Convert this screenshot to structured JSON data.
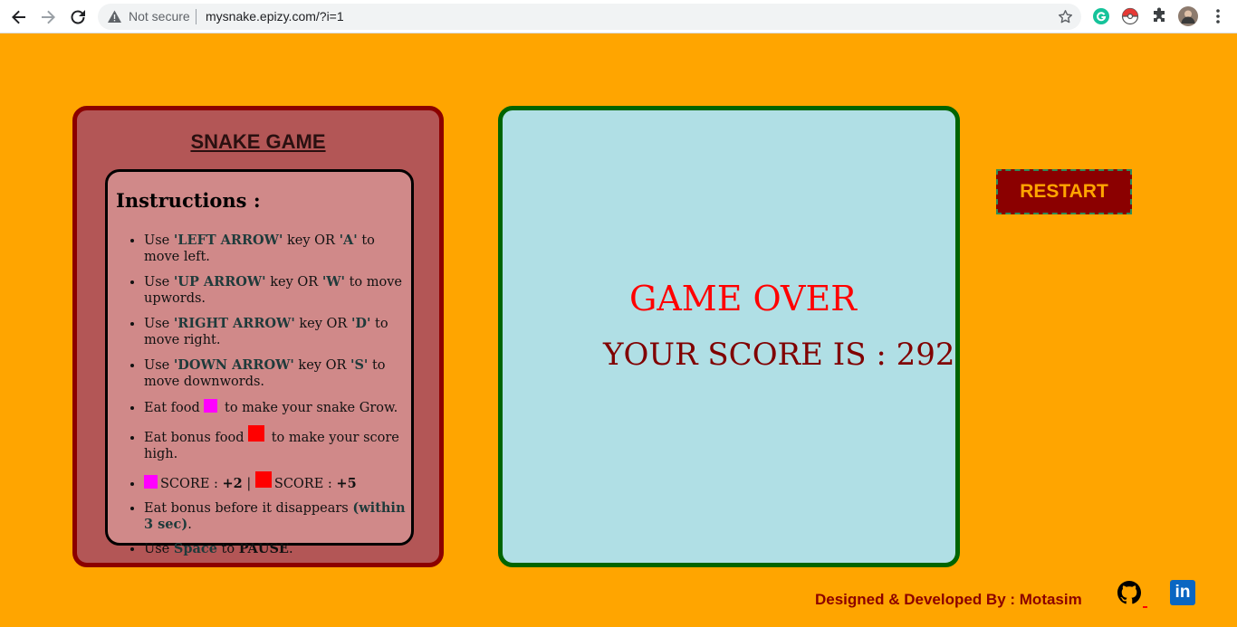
{
  "browser": {
    "security_label": "Not secure",
    "url": "mysnake.epizy.com/?i=1",
    "extensions": [
      "grammarly-icon",
      "pokeball-icon",
      "puzzle-icon",
      "profile-avatar"
    ]
  },
  "instructions_panel": {
    "title": "SNAKE GAME",
    "heading": "Instructions :",
    "items": {
      "left": {
        "pre": "Use ",
        "key1": "'LEFT ARROW'",
        "mid": " key OR ",
        "key2": "'A'",
        "post": " to move left."
      },
      "up": {
        "pre": "Use ",
        "key1": "'UP ARROW'",
        "mid": " key OR ",
        "key2": "'W'",
        "post": " to move upwords."
      },
      "right": {
        "pre": "Use ",
        "key1": "'RIGHT ARROW'",
        "mid": " key OR ",
        "key2": "'D'",
        "post": " to move right."
      },
      "down": {
        "pre": "Use ",
        "key1": "'DOWN ARROW'",
        "mid": " key OR ",
        "key2": "'S'",
        "post": " to move downwords."
      },
      "food": {
        "pre": "Eat food ",
        "post": " to make your snake Grow."
      },
      "bonus": {
        "pre": "Eat bonus food ",
        "post": " to make your score high."
      },
      "scores": {
        "label1": "SCORE : ",
        "val1": "+2",
        "sep": " | ",
        "label2": "SCORE : ",
        "val2": "+5"
      },
      "disappear": {
        "pre": "Eat bonus before it disappears ",
        "key": "(within 3 sec)",
        "post": "."
      },
      "pause": {
        "pre": "Use ",
        "key": "Space",
        "mid": " to ",
        "key2": "PAUSE",
        "post": "."
      }
    }
  },
  "game": {
    "over_text": "GAME OVER",
    "score_label": "YOUR SCORE IS : ",
    "score_value": "292"
  },
  "controls": {
    "restart_label": "RESTART"
  },
  "footer": {
    "credit": "Designed & Developed By : Motasim",
    "linkedin_label": "in"
  },
  "colors": {
    "page_background": "#ffa500",
    "food": "#ff00ff",
    "bonus_food": "#ff0000",
    "game_over_text": "#ff0000",
    "score_text": "#800000"
  }
}
